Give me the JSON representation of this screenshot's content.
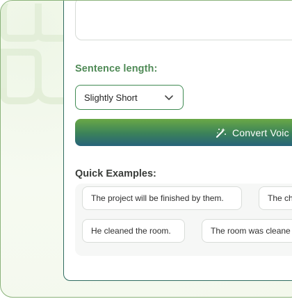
{
  "settings": {
    "sentence_length_label": "Sentence length:",
    "sentence_length_value": "Slightly Short"
  },
  "convert_button": {
    "label": "Convert Voic",
    "icon": "magic-wand-icon"
  },
  "quick_examples": {
    "title": "Quick Examples:",
    "items": [
      "The project will be finished by them.",
      "The ch",
      "He cleaned the room.",
      "The room was cleane"
    ]
  },
  "colors": {
    "accent_green": "#4f8a56",
    "button_gradient_top": "#6aa846",
    "button_gradient_bottom": "#27637a",
    "card_border": "#2e6b5f"
  }
}
